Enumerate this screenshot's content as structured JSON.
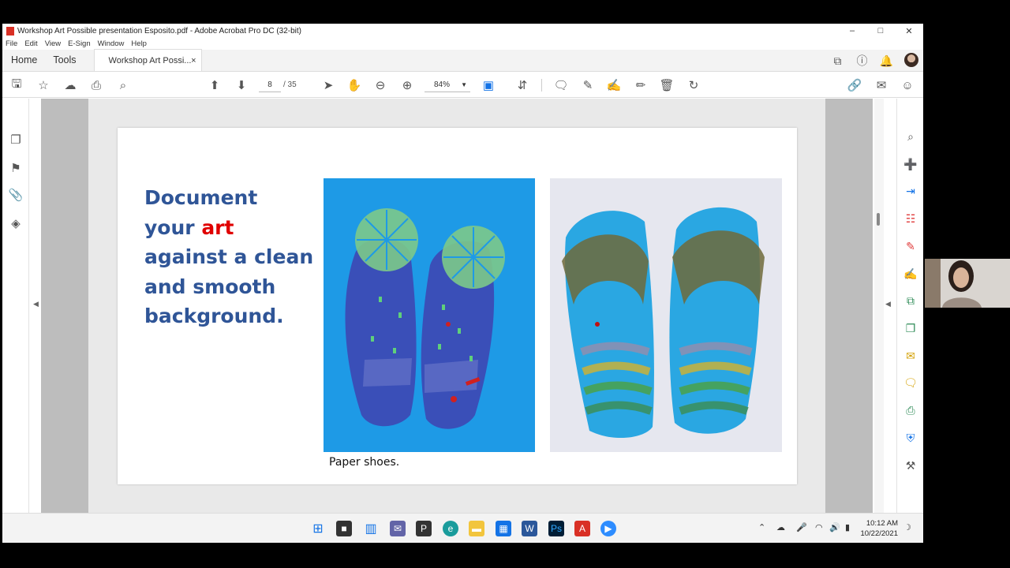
{
  "window": {
    "title": "Workshop Art Possible presentation Esposito.pdf - Adobe Acrobat Pro DC (32-bit)",
    "controls": {
      "minimize": "–",
      "maximize": "□",
      "close": "✕"
    }
  },
  "menu": [
    "File",
    "Edit",
    "View",
    "E-Sign",
    "Window",
    "Help"
  ],
  "tabs": {
    "home": "Home",
    "tools": "Tools",
    "document": "Workshop Art Possi...",
    "close": "×"
  },
  "toolbar": {
    "page_current": "8",
    "page_total": "/ 35",
    "zoom": "84%"
  },
  "slide": {
    "heading_part1": "Document",
    "heading_part2": "your ",
    "heading_highlight": "art",
    "heading_part3": "against a clean",
    "heading_part4": "and smooth",
    "heading_part5": "background.",
    "caption": "Paper shoes.",
    "highlight_color": "#e00000",
    "text_color": "#2f5597"
  },
  "icons": {
    "left_rail": [
      "pages-icon",
      "bookmark-icon",
      "attachment-icon",
      "layers-icon"
    ],
    "right_rail": [
      "zoom-search-icon",
      "create-pdf-icon",
      "export-pdf-icon",
      "organize-pages-icon",
      "edit-pdf-icon",
      "fill-sign-icon",
      "compress-icon",
      "combine-icon",
      "send-review-icon",
      "comment-icon",
      "print-production-icon",
      "protect-icon",
      "more-tools-icon",
      "expand-panel-icon"
    ]
  },
  "taskbar": {
    "apps": [
      "windows-start-icon",
      "file-manager-icon",
      "snap-icon",
      "teams-icon",
      "p-app-icon",
      "edge-icon",
      "file-explorer-icon",
      "calculator-icon",
      "word-icon",
      "photoshop-icon",
      "acrobat-icon",
      "zoom-icon"
    ],
    "time": "10:12 AM",
    "date": "10/22/2021"
  }
}
